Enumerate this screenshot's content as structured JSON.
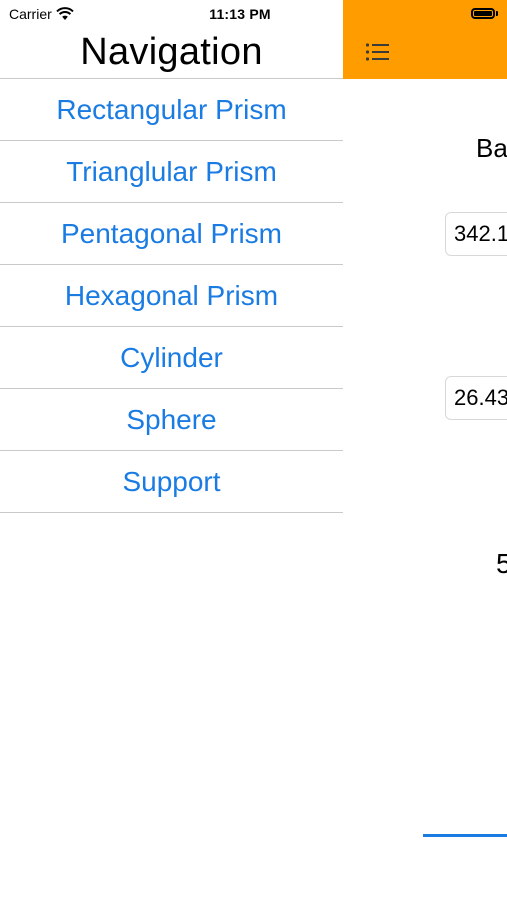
{
  "status_bar": {
    "carrier": "Carrier",
    "time": "11:13 PM",
    "icons": [
      "wifi-icon",
      "battery-icon"
    ]
  },
  "drawer": {
    "title": "Navigation",
    "items": [
      {
        "label": "Rectangular Prism"
      },
      {
        "label": "Trianglular Prism"
      },
      {
        "label": "Pentagonal Prism"
      },
      {
        "label": "Hexagonal Prism"
      },
      {
        "label": "Cylinder"
      },
      {
        "label": "Sphere"
      },
      {
        "label": "Support"
      }
    ],
    "link_color": "#1a7ce3",
    "divider_color": "#c9c9c9"
  },
  "main": {
    "header_color": "#ff9d00",
    "menu_icon": "list-menu-icon",
    "label_partial": "Ba",
    "input_1_value": "342.1",
    "input_2_value": "26.43",
    "result_partial": "5"
  }
}
